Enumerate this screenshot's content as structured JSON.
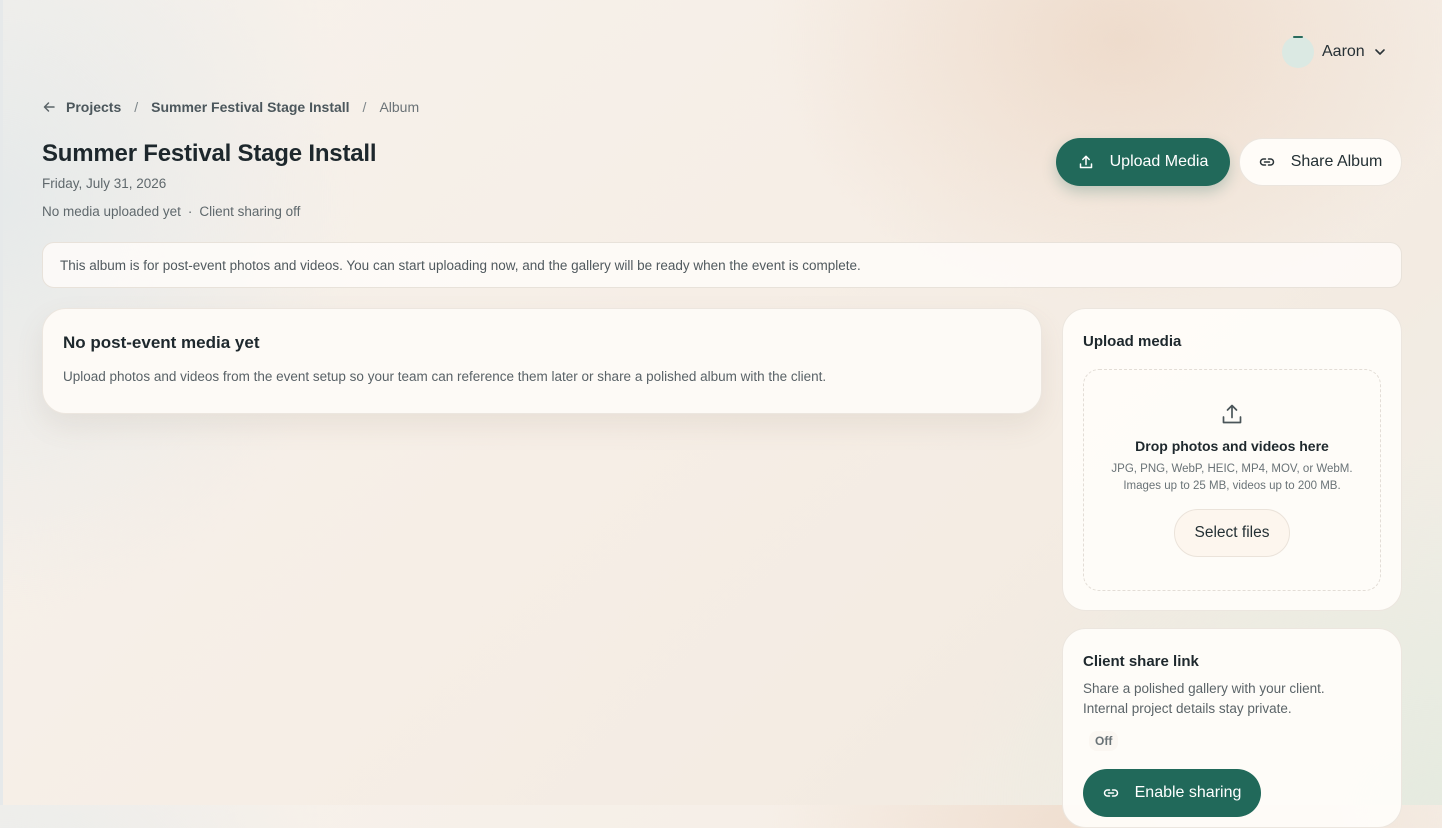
{
  "user": {
    "name": "Aaron"
  },
  "breadcrumb": {
    "projects": "Projects",
    "project": "Summer Festival Stage Install",
    "current": "Album",
    "separator": "/"
  },
  "header": {
    "title": "Summer Festival Stage Install",
    "date": "Friday, July 31, 2026",
    "media_status": "No media uploaded yet",
    "status_separator": "·",
    "sharing_status": "Client sharing off",
    "upload_button": "Upload Media",
    "share_button": "Share Album"
  },
  "notice": "This album is for post-event photos and videos. You can start uploading now, and the gallery will be ready when the event is complete.",
  "empty_state": {
    "title": "No post-event media yet",
    "description": "Upload photos and videos from the event setup so your team can reference them later or share a polished album with the client."
  },
  "upload_panel": {
    "title": "Upload media",
    "drop_title": "Drop photos and videos here",
    "types": "JPG, PNG, WebP, HEIC, MP4, MOV, or WebM.",
    "limits": "Images up to 25 MB, videos up to 200 MB.",
    "select_button": "Select files"
  },
  "share_panel": {
    "title": "Client share link",
    "description_line1": "Share a polished gallery with your client.",
    "description_line2": "Internal project details stay private.",
    "status": "Off",
    "enable_button": "Enable sharing"
  },
  "colors": {
    "accent": "#21695a",
    "text": "#1f2a2e",
    "muted": "#5f686c"
  },
  "icons": {
    "back": "arrow-left-icon",
    "upload": "upload-icon",
    "link": "link-icon",
    "chevron": "chevron-down-icon"
  }
}
